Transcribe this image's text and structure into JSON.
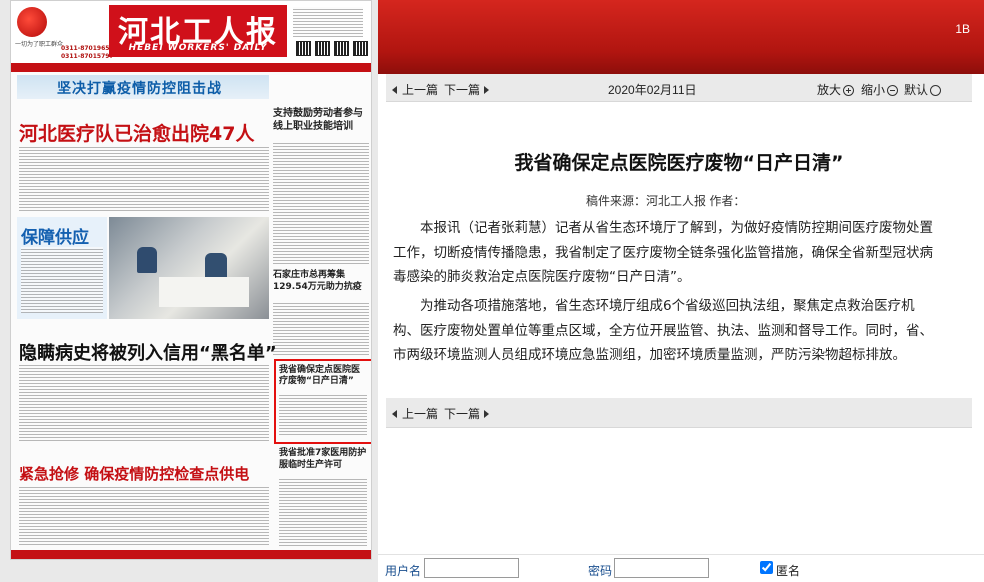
{
  "newspaper": {
    "masthead_title": "河北工人报",
    "masthead_title_en": "HEBEI WORKERS' DAILY",
    "slogan": "一切为了职工群众",
    "phone_1": "0311-87019650",
    "phone_2": "0311-87015797",
    "banner": "坚决打赢疫情防控阻击战",
    "headline_1": "河北医疗队已治愈出院47人",
    "headline_2": "支持鼓励劳动者参与线上职业技能培训",
    "headline_3": "保障供应",
    "headline_4": "石家庄市总再筹集129.54万元助力抗疫",
    "headline_5": "隐瞒病史将被列入信用“黑名单”",
    "headline_6": "我省确保定点医院医疗废物“日产日清”",
    "headline_7": "紧急抢修 确保疫情防控检查点供电",
    "headline_8": "我省批准7家医用防护服临时生产许可"
  },
  "page_code": "1B",
  "nav": {
    "prev_label": "上一篇",
    "next_label": "下一篇",
    "date": "2020年02月11日",
    "zoom_in_label": "放大",
    "zoom_out_label": "缩小",
    "default_label": "默认"
  },
  "article": {
    "title": "我省确保定点医院医疗废物“日产日清”",
    "source": "稿件来源：河北工人报  作者：",
    "paragraphs": [
      "本报讯（记者张莉慧）记者从省生态环境厅了解到，为做好疫情防控期间医疗废物处置工作，切断疫情传播隐患，我省制定了医疗废物全链条强化监管措施，确保全省新型冠状病毒感染的肺炎救治定点医院医疗废物“日产日清”。",
      "为推动各项措施落地，省生态环境厅组成6个省级巡回执法组，聚焦定点救治医疗机构、医疗废物处置单位等重点区域，全方位开展监管、执法、监测和督导工作。同时，省、市两级环境监测人员组成环境应急监测组，加密环境质量监测，严防污染物超标排放。"
    ]
  },
  "login": {
    "username_label": "用户名",
    "username_value": "",
    "password_label": "密码",
    "password_value": "",
    "anonymous_label": "匿名",
    "anonymous_checked": true
  },
  "colors": {
    "header_red": "#c41014",
    "highlight_red": "#e3100f",
    "nav_bg": "#eaeaea",
    "link_blue": "#1a4f8f"
  }
}
